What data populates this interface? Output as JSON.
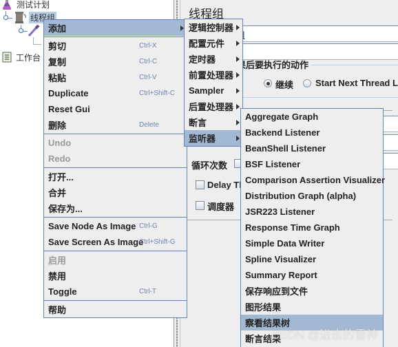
{
  "tree": {
    "nodes": [
      {
        "label": "测试计划",
        "icon": "test-plan-flask-icon"
      },
      {
        "label": "线程组",
        "icon": "thread-group-spool-icon",
        "selected": true
      },
      {
        "label": "",
        "icon": "sampler-dropper-icon"
      },
      {
        "label": "工作台",
        "icon": "workbench-clipboard-icon"
      }
    ]
  },
  "panel": {
    "title": "线程组",
    "name_value": "组",
    "error_action_group": "果后要执行的动作",
    "radio_continue": "继续",
    "radio_start_next": "Start Next Thread Loo",
    "loop_count_label": "循环次数",
    "delay_thread_label": "Delay Th",
    "scheduler_label": "调度器"
  },
  "context_menu": {
    "items": [
      {
        "label": "添加",
        "submenu": true,
        "highlighted": true
      },
      {
        "separator": true
      },
      {
        "label": "剪切",
        "shortcut": "Ctrl-X"
      },
      {
        "label": "复制",
        "shortcut": "Ctrl-C"
      },
      {
        "label": "粘贴",
        "shortcut": "Ctrl-V"
      },
      {
        "label": "Duplicate",
        "shortcut": "Ctrl+Shift-C"
      },
      {
        "label": "Reset Gui"
      },
      {
        "label": "删除",
        "shortcut": "Delete"
      },
      {
        "separator": true
      },
      {
        "label": "Undo",
        "disabled": true
      },
      {
        "label": "Redo",
        "disabled": true
      },
      {
        "separator": true
      },
      {
        "label": "打开..."
      },
      {
        "label": "合并"
      },
      {
        "label": "保存为..."
      },
      {
        "separator": true
      },
      {
        "label": "Save Node As Image",
        "shortcut": "Ctrl-G"
      },
      {
        "label": "Save Screen As Image",
        "shortcut": "Ctrl+Shift-G"
      },
      {
        "separator": true
      },
      {
        "label": "启用",
        "disabled": true
      },
      {
        "label": "禁用"
      },
      {
        "label": "Toggle",
        "shortcut": "Ctrl-T"
      },
      {
        "separator": true
      },
      {
        "label": "帮助"
      }
    ]
  },
  "add_submenu": {
    "items": [
      {
        "label": "逻辑控制器"
      },
      {
        "label": "配置元件"
      },
      {
        "label": "定时器"
      },
      {
        "label": "前置处理器"
      },
      {
        "label": "Sampler"
      },
      {
        "label": "后置处理器"
      },
      {
        "label": "断言"
      },
      {
        "label": "监听器",
        "highlighted": true
      }
    ]
  },
  "listener_submenu": {
    "items": [
      {
        "label": "Aggregate Graph"
      },
      {
        "label": "Backend Listener"
      },
      {
        "label": "BeanShell Listener"
      },
      {
        "label": "BSF Listener"
      },
      {
        "label": "Comparison Assertion Visualizer"
      },
      {
        "label": "Distribution Graph (alpha)"
      },
      {
        "label": "JSR223 Listener"
      },
      {
        "label": "Response Time Graph"
      },
      {
        "label": "Simple Data Writer"
      },
      {
        "label": "Spline Visualizer"
      },
      {
        "label": "Summary Report"
      },
      {
        "label": "保存响应到文件"
      },
      {
        "label": "图形结果"
      },
      {
        "label": "察看结果树",
        "highlighted": true
      },
      {
        "label": "断言结果"
      }
    ]
  },
  "watermark": "CSDN @进击的雷神",
  "colors": {
    "menu_border": "#6382bf",
    "highlight": "#a3b8d2",
    "shortcut": "#6d83b0",
    "disabled": "#9a9a9a",
    "tree_selection": "#b8cfe5"
  }
}
